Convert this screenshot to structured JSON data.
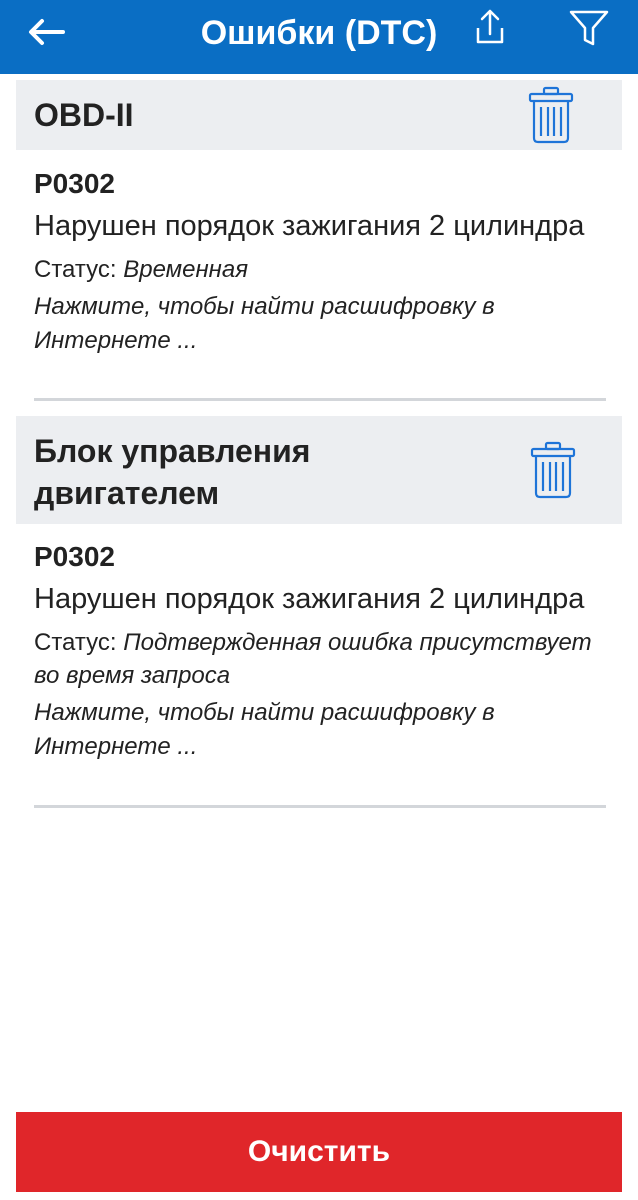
{
  "header": {
    "title": "Ошибки (DTC)",
    "back_icon": "arrow-left-icon",
    "share_icon": "share-upload-icon",
    "filter_icon": "filter-funnel-icon",
    "color": "#0a6ec4"
  },
  "sections": [
    {
      "name": "OBD-II",
      "delete_icon": "trash-icon",
      "dtcs": [
        {
          "code": "P0302",
          "description": "Нарушен порядок зажигания 2 цилиндра",
          "status_label": "Статус:",
          "status_value": "Временная",
          "link_text": "Нажмите, чтобы найти расшифровку в Интернете ..."
        }
      ]
    },
    {
      "name": "Блок управления двигателем",
      "delete_icon": "trash-icon",
      "dtcs": [
        {
          "code": "P0302",
          "description": "Нарушен порядок зажигания 2 цилиндра",
          "status_label": "Статус:",
          "status_value": "Подтвержденная ошибка присутствует во время запроса",
          "link_text": "Нажмите, чтобы найти расшифровку в Интернете ..."
        }
      ]
    }
  ],
  "footer": {
    "clear_label": "Очистить",
    "clear_color": "#e0262a"
  },
  "colors": {
    "section_bg": "#eceef1",
    "icon_blue": "#1e74d8",
    "divider": "#d3d6da"
  }
}
